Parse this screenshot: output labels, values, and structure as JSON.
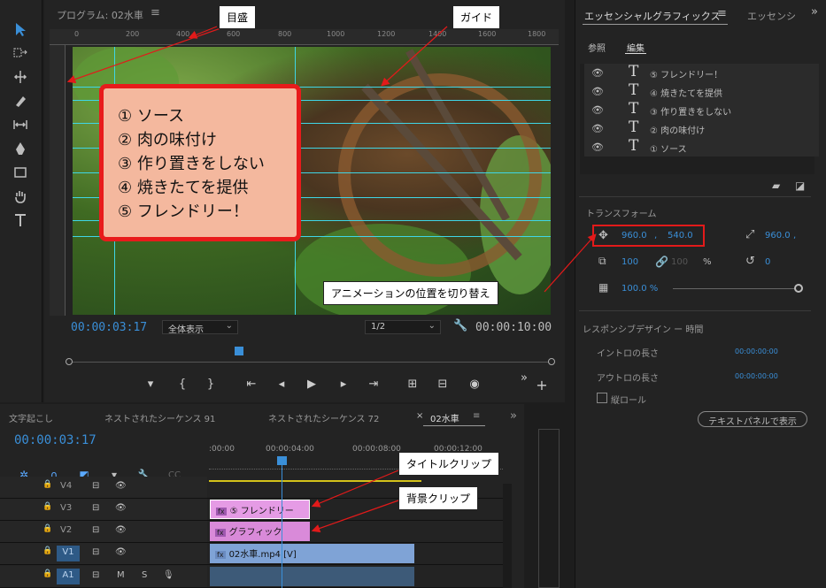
{
  "program": {
    "title": "プログラム: 02水車",
    "menu_icon": "≡",
    "ruler_ticks": [
      "0",
      "200",
      "400",
      "600",
      "800",
      "1000",
      "1200",
      "1400",
      "1600",
      "1800"
    ],
    "timecode_current": "00:00:03:17",
    "timecode_duration": "00:00:10:00",
    "zoom": "全体表示",
    "resolution": "1/2"
  },
  "title_lines": [
    "① ソース",
    "② 肉の味付け",
    "③ 作り置きをしない",
    "④ 焼きたてを提供",
    "⑤ フレンドリー！"
  ],
  "timeline": {
    "tabs": [
      "文字起こし",
      "ネストされたシーケンス 91",
      "ネストされたシーケンス 72",
      "02水車"
    ],
    "close_icon": "×",
    "menu_icon": "≡",
    "more_icon": "»",
    "timecode": "00:00:03:17",
    "ruler_labels": [
      ":00:00",
      "00:00:04:00",
      "00:00:08:00",
      "00:00:12:00"
    ],
    "tracks": [
      {
        "name": "V4"
      },
      {
        "name": "V3"
      },
      {
        "name": "V2"
      },
      {
        "name": "V1"
      },
      {
        "name": "A1"
      }
    ],
    "clips": {
      "title": "⑤ フレンドリー",
      "graphic": "グラフィック",
      "video": "02水車.mp4 [V]"
    },
    "v1_label": "V1",
    "a1_label": "A1",
    "audio_buttons": [
      "M",
      "S"
    ]
  },
  "essential_graphics": {
    "tab_active": "エッセンシャルグラフィックス",
    "tab_other": "エッセンシ",
    "menu_icon": "≡",
    "more_icon": "»",
    "subtab_browse": "参照",
    "subtab_edit": "編集",
    "layers": [
      "⑤ フレンドリー！",
      "④ 焼きたてを提供",
      "③ 作り置きをしない",
      "② 肉の味付け",
      "① ソース"
    ],
    "transform_label": "トランスフォーム",
    "position_x": "960.0",
    "position_y": "540.0",
    "position_sep": ",",
    "anchor_x": "960.0",
    "anchor_sep": ",",
    "scale": "100",
    "scale_h": "100",
    "percent": "%",
    "rotation": "0",
    "opacity": "100.0 %",
    "responsive_label": "レスポンシブデザイン ー 時間",
    "intro_label": "イントロの長さ",
    "intro_value": "00:00:00:00",
    "outro_label": "アウトロの長さ",
    "outro_value": "00:00:00:00",
    "roll_label": "縦ロール",
    "text_panel_button": "テキストパネルで表示"
  },
  "callouts": {
    "ruler": "目盛",
    "guide": "ガイド",
    "anim": "アニメーションの位置を切り替え",
    "title_clip": "タイトルクリップ",
    "bg_clip": "背景クリップ"
  },
  "colors": {
    "accent_blue": "#3a8fd8",
    "guide_cyan": "#3fd6e6",
    "callout_red": "#e21a1a",
    "clip_pink": "#d98ad9",
    "clip_video": "#7fa3d6"
  }
}
